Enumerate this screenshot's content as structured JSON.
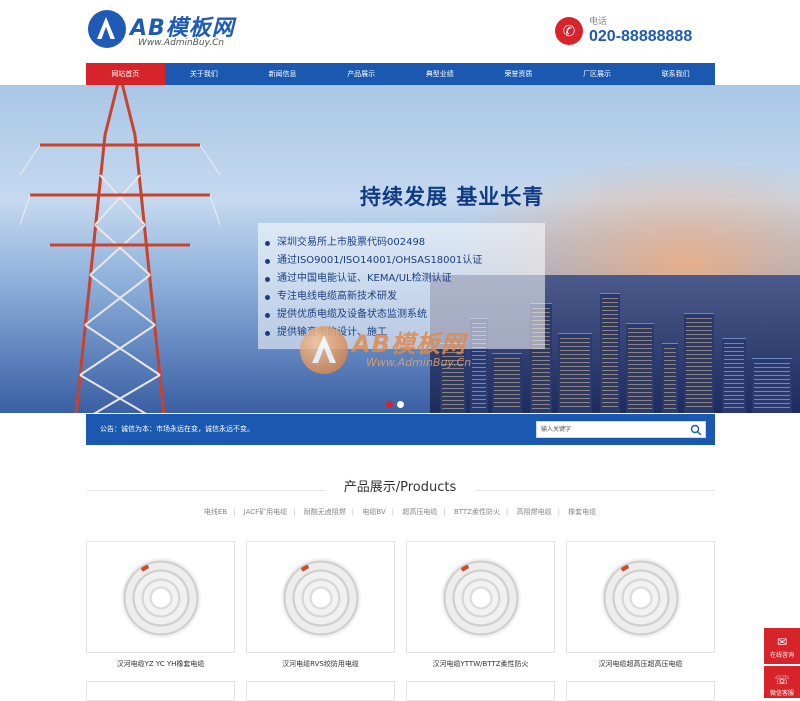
{
  "header": {
    "logo_title": "AB模板网",
    "logo_sub": "Www.AdminBuy.Cn",
    "phone_label": "电话",
    "phone_number": "020-88888888"
  },
  "nav": [
    "网站首页",
    "关于我们",
    "新闻信息",
    "产品展示",
    "典型业绩",
    "荣誉资质",
    "厂区展示",
    "联系我们"
  ],
  "banner": {
    "heading": "持续发展 基业长青",
    "bullets": [
      "深圳交易所上市股票代码002498",
      "通过ISO9001/ISO14001/OHSAS18001认证",
      "通过中国电能认证、KEMA/UL检测认证",
      "专注电线电缆高新技术研发",
      "提供优质电缆及设备状态监测系统",
      "提供输变电的设计、施工"
    ],
    "watermark_title": "AB模板网",
    "watermark_sub": "Www.AdminBuy.Cn",
    "slide_count": 2,
    "active_slide": 1
  },
  "notice": {
    "text": "公告：诚信为本：市场永远在变，诚信永远不变。",
    "search_placeholder": "输入关键字"
  },
  "products": {
    "title": "产品展示/Products",
    "categories": [
      "电线EB",
      "JACF矿用电缆",
      "耐酸无卤阻燃",
      "电缆BV",
      "超高压电缆",
      "BTTZ柔性防火",
      "高阻燃电缆",
      "橡套电缆"
    ],
    "items": [
      "汉河电缆YZ YC YH橡套电缆",
      "汉河电缆RVS绞防用电缆",
      "汉河电缆YTTW/BTTZ柔性防火",
      "汉河电缆超高压超高压电缆"
    ]
  },
  "side": {
    "consult_label": "在线咨询",
    "wechat_label": "微信客服"
  },
  "colors": {
    "brand": "#1b58b0",
    "accent": "#d7232a"
  }
}
